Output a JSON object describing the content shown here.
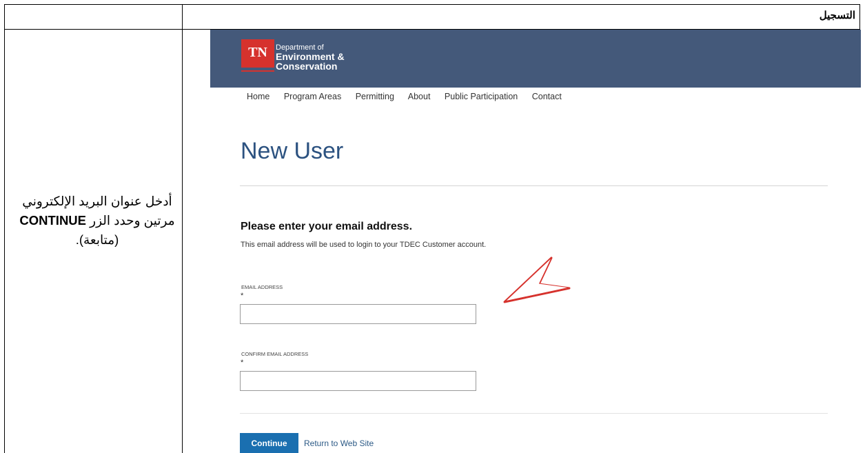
{
  "document": {
    "header_label": "التسجيل",
    "instruction_before": "أدخل عنوان البريد الإلكتروني مرتين وحدد الزر",
    "instruction_bold": "CONTINUE",
    "instruction_after": "(متابعة)."
  },
  "site": {
    "logo_text": "TN",
    "dept_line1": "Department of",
    "dept_line2": "Environment &",
    "dept_line3": "Conservation",
    "brand_color": "#44597a",
    "logo_color": "#d6322d"
  },
  "nav": {
    "items": [
      "Home",
      "Program Areas",
      "Permitting",
      "About",
      "Public Participation",
      "Contact"
    ]
  },
  "page": {
    "title": "New User",
    "heading": "Please enter your email address.",
    "subtext": "This email address will be used to login to your TDEC Customer account."
  },
  "form": {
    "email_label": "EMAIL ADDRESS",
    "email_required": "*",
    "email_value": "",
    "confirm_label": "CONFIRM EMAIL ADDRESS",
    "confirm_required": "*",
    "confirm_value": ""
  },
  "actions": {
    "continue_label": "Continue",
    "return_label": "Return to Web Site",
    "accent_color": "#1a6fb0"
  },
  "annotation": {
    "icon": "red-arrow-pointer-icon",
    "color": "#d6322d"
  }
}
